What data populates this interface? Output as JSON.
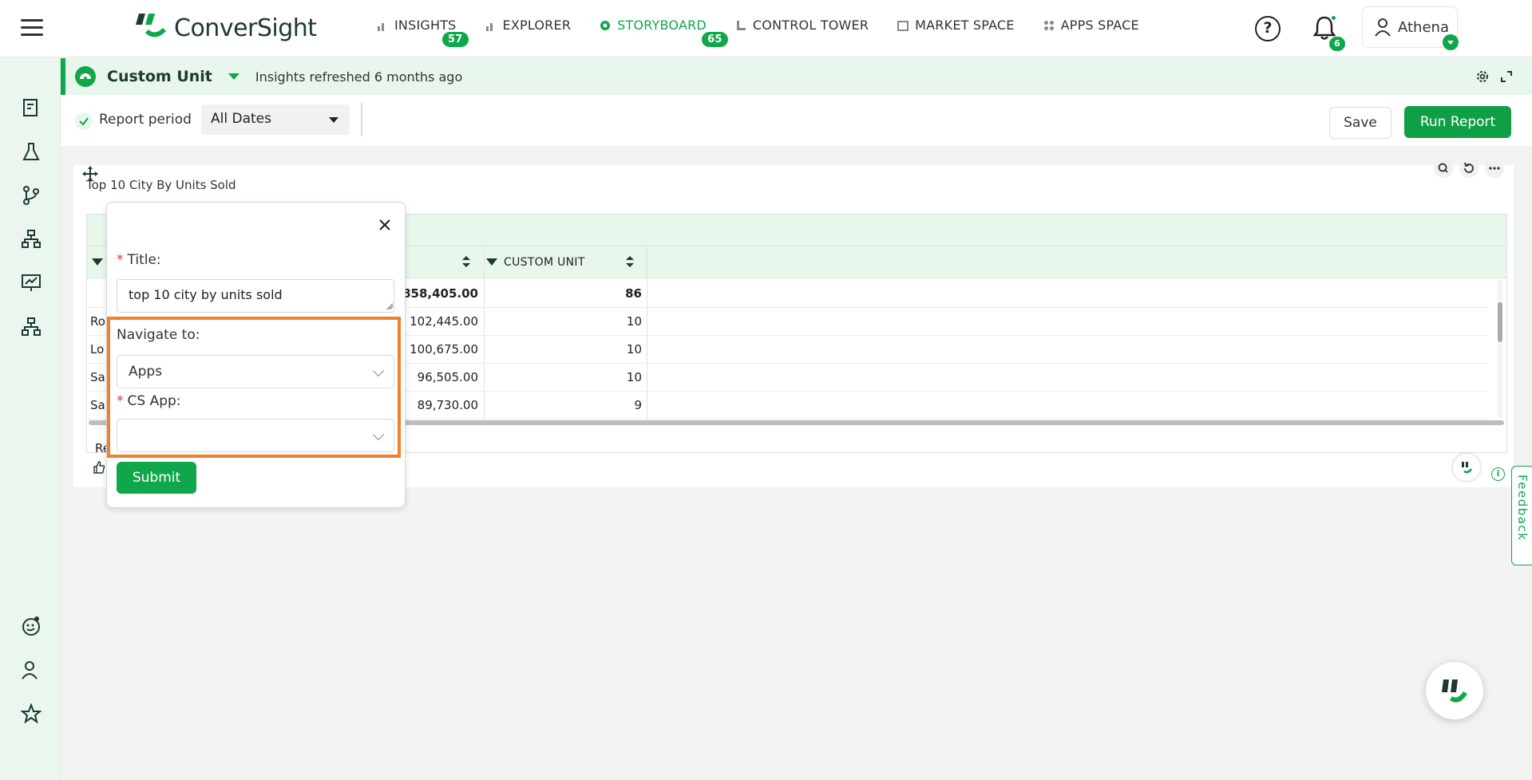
{
  "app": {
    "logo_text": "ConverSight",
    "brand_color": "#10a64a"
  },
  "nav": [
    {
      "label": "INSIGHTS",
      "badge": "57",
      "icon": "bar-chart-icon"
    },
    {
      "label": "EXPLORER",
      "badge": "",
      "icon": "bar-chart-icon"
    },
    {
      "label": "STORYBOARD",
      "badge": "65",
      "icon": "storyboard-icon",
      "active": true
    },
    {
      "label": "CONTROL TOWER",
      "badge": "",
      "icon": "control-tower-icon"
    },
    {
      "label": "MARKET SPACE",
      "badge": "",
      "icon": "market-space-icon"
    },
    {
      "label": "APPS SPACE",
      "badge": "",
      "icon": "apps-grid-icon"
    }
  ],
  "header": {
    "help_glyph": "?",
    "notification_count": "6",
    "user_name": "Athena"
  },
  "subheader": {
    "title": "Custom Unit",
    "refresh_text": "Insights refreshed 6 months ago"
  },
  "filters": {
    "report_period_label": "Report period",
    "date_value": "All Dates",
    "save_label": "Save",
    "run_label": "Run Report"
  },
  "widget": {
    "title": "Top 10 City By Units Sold",
    "columns": [
      "",
      "CUSTOM UNIT"
    ],
    "total_row": {
      "value": "858,405.00",
      "custom": "86"
    },
    "rows": [
      {
        "label": "Ro",
        "value": "102,445.00",
        "custom": "10"
      },
      {
        "label": "Lo",
        "value": "100,675.00",
        "custom": "10"
      },
      {
        "label": "Sa",
        "value": "96,505.00",
        "custom": "10"
      },
      {
        "label": "Sa",
        "value": "89,730.00",
        "custom": "9"
      }
    ],
    "footer_fragment": "Re"
  },
  "popup": {
    "title_label": "Title:",
    "title_value": "top 10 city by units sold",
    "navigate_label": "Navigate to:",
    "navigate_value": "Apps",
    "cs_app_label": "CS App:",
    "cs_app_value": "",
    "submit_label": "Submit",
    "required_mark": "*"
  },
  "feedback_label": "Feedback",
  "info_glyph": "i"
}
